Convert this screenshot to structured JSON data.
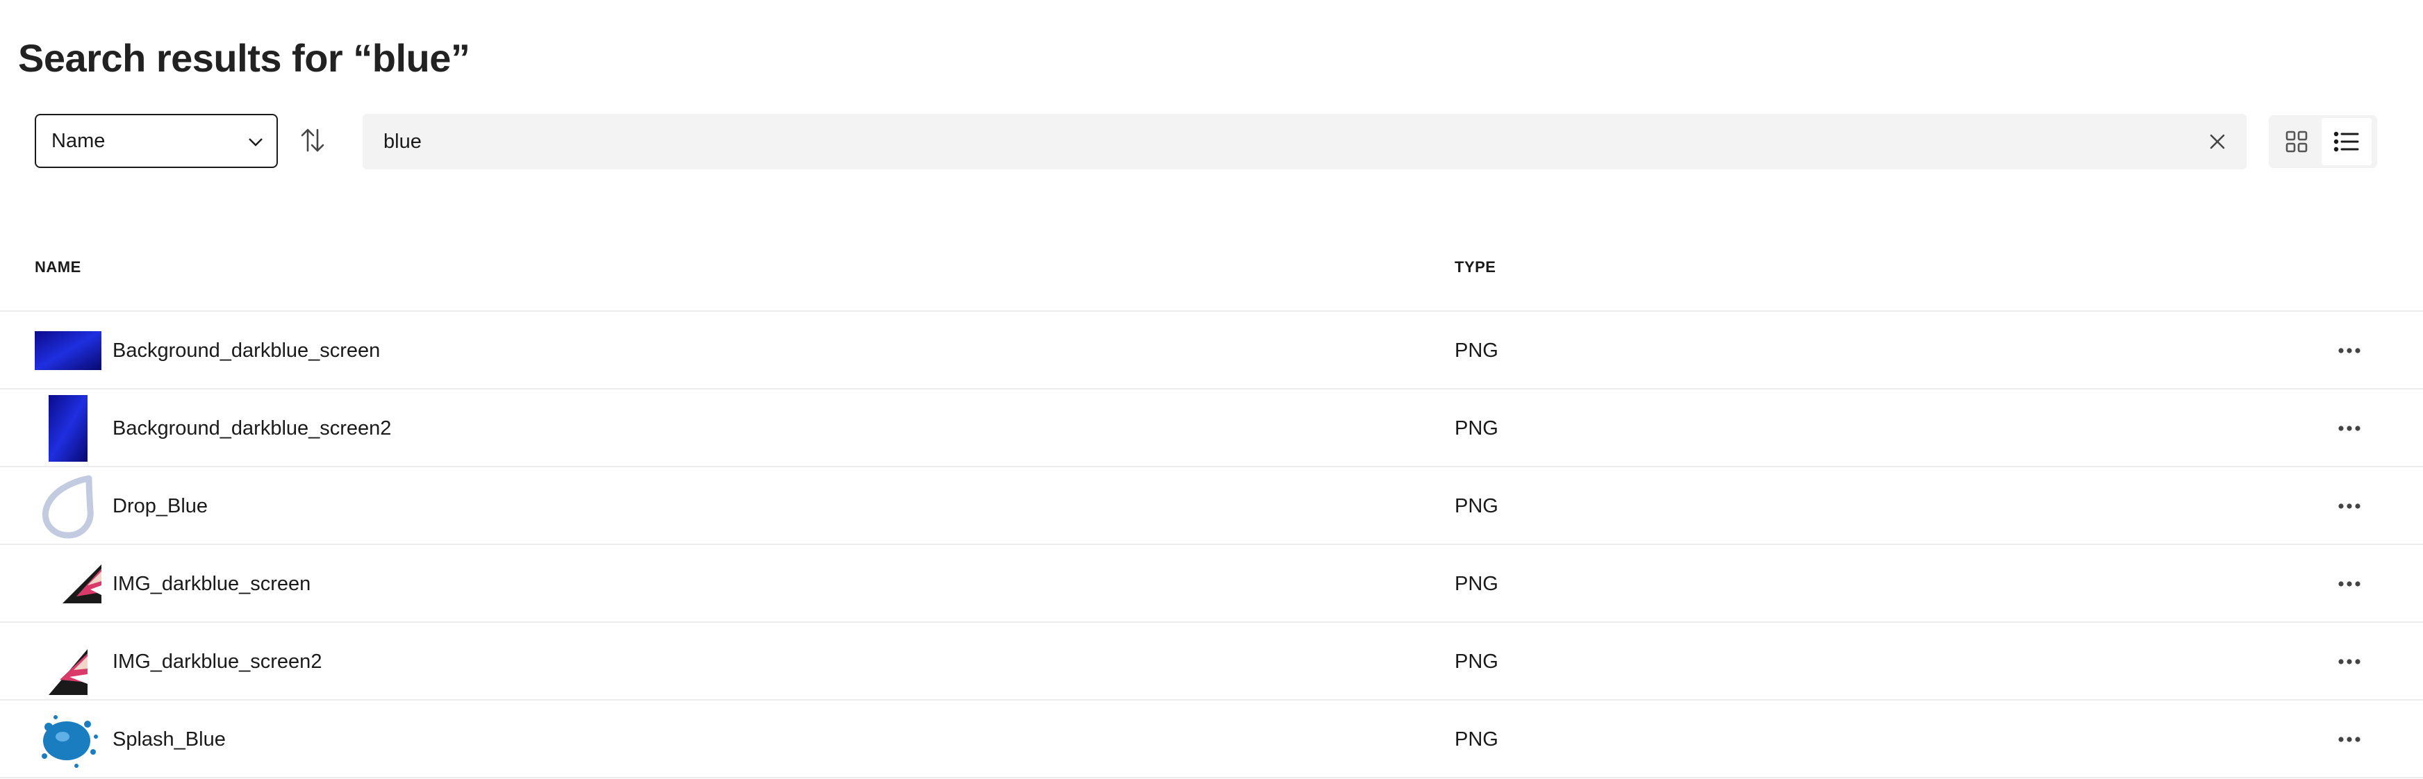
{
  "page": {
    "title": "Search results for “blue”"
  },
  "toolbar": {
    "sort_field": "Name",
    "search_value": "blue",
    "icons": {
      "sort_dropdown": "chevron-down-icon",
      "sort_direction": "sort-direction-icon",
      "clear": "close-icon",
      "grid_view": "grid-view-icon",
      "list_view": "list-view-icon"
    },
    "active_view": "list"
  },
  "table": {
    "headers": {
      "name": "NAME",
      "type": "TYPE"
    },
    "rows": [
      {
        "name": "Background_darkblue_screen",
        "type": "PNG",
        "thumb": "dark-blue-gradient-landscape"
      },
      {
        "name": "Background_darkblue_screen2",
        "type": "PNG",
        "thumb": "dark-blue-gradient-portrait"
      },
      {
        "name": "Drop_Blue",
        "type": "PNG",
        "thumb": "light-blue-drop-outline"
      },
      {
        "name": "IMG_darkblue_screen",
        "type": "PNG",
        "thumb": "photo-diagonal-crop"
      },
      {
        "name": "IMG_darkblue_screen2",
        "type": "PNG",
        "thumb": "photo-diagonal-crop-portrait"
      },
      {
        "name": "Splash_Blue",
        "type": "PNG",
        "thumb": "blue-paint-splash"
      }
    ],
    "row_action_icon": "more-horizontal-icon"
  },
  "colors": {
    "thumb_blue_dark": "#0a0a9e",
    "thumb_blue_bright": "#1f2fe0",
    "drop_outline": "#c2cbe0",
    "splash_blue": "#1a7dc0"
  }
}
